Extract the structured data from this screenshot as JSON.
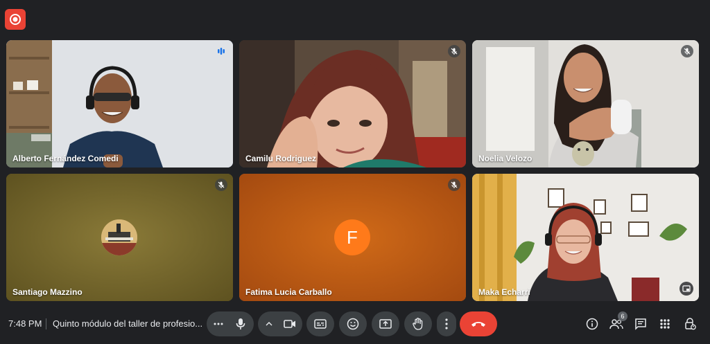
{
  "recording": {
    "icon": "record-icon",
    "color": "#ea4335"
  },
  "participants": [
    {
      "name": "Alberto Fernández Comedi",
      "state": "speaking",
      "video": true
    },
    {
      "name": "Camilu Rodriguez",
      "state": "muted",
      "video": true
    },
    {
      "name": "Noelia Velozo",
      "state": "muted",
      "video": true
    },
    {
      "name": "Santiago Mazzino",
      "state": "muted",
      "video": false
    },
    {
      "name": "Fatima Lucia Carballo",
      "state": "muted",
      "video": false,
      "avatar_letter": "F"
    },
    {
      "name": "Maka Echarri",
      "state": "unmuted",
      "video": true
    }
  ],
  "bottombar": {
    "time": "7:48 PM",
    "meeting_title": "Quinto módulo del taller de profesio...",
    "people_count": "6"
  },
  "colors": {
    "background": "#202124",
    "control": "#3c4043",
    "end_call": "#ea4335",
    "active_outline": "#8ab4f8",
    "avatar_orange": "#ff7a1a"
  }
}
